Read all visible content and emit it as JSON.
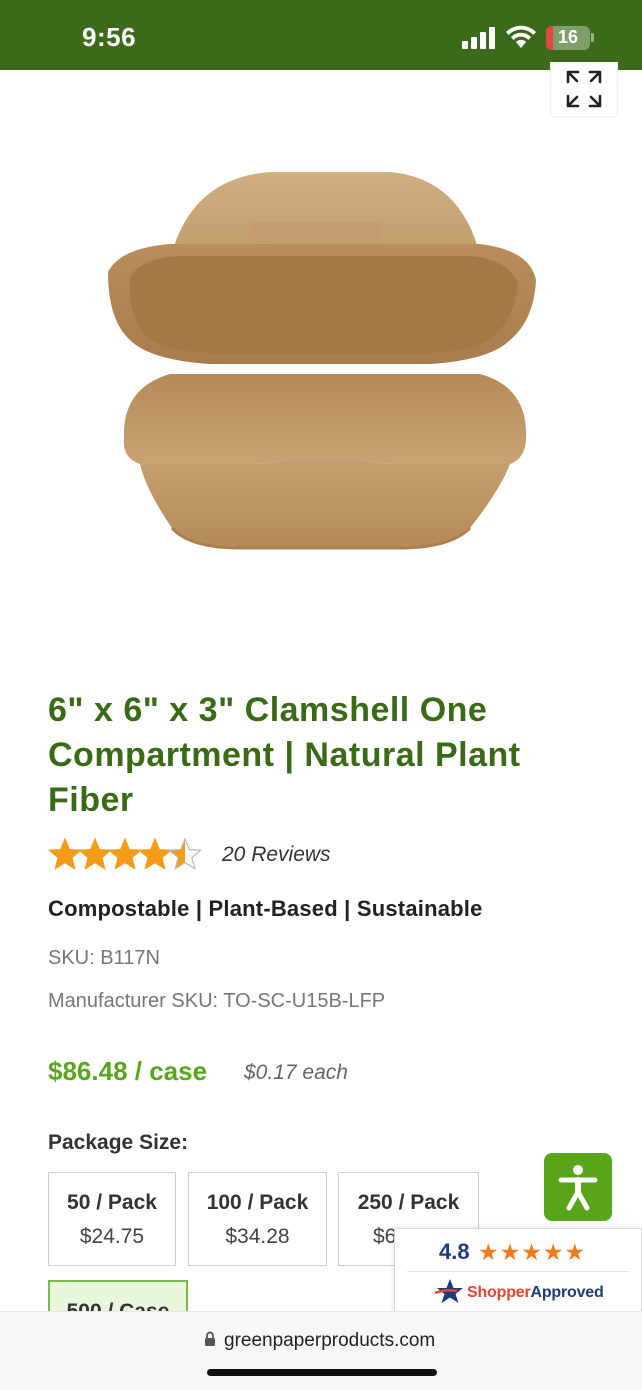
{
  "status_bar": {
    "time": "9:56",
    "battery_level": "16",
    "battery_fraction": 0.16
  },
  "product": {
    "title": "6\" x 6\" x 3\" Clamshell One Compartment | Natural Plant Fiber",
    "rating": 4.5,
    "reviews_label": "20 Reviews",
    "tagline": "Compostable | Plant-Based | Sustainable",
    "sku": "SKU: B117N",
    "manufacturer_sku": "Manufacturer SKU: TO-SC-U15B-LFP",
    "price": "$86.48 / case",
    "unit_price": "$0.17 each"
  },
  "package": {
    "label": "Package Size:",
    "options": [
      {
        "name": "50 / Pack",
        "price": "$24.75"
      },
      {
        "name": "100 / Pack",
        "price": "$34.28"
      },
      {
        "name": "250 / Pack",
        "price": "$6"
      },
      {
        "name": "500 / Case",
        "price": "",
        "selected": true
      }
    ]
  },
  "shopper_approved": {
    "rating": "4.8",
    "stars": "★★★★★",
    "brand_part1": "Shopper",
    "brand_part2": "Approved"
  },
  "browser": {
    "url": "greenpaperproducts.com"
  },
  "colors": {
    "brand_green": "#3c6a1a",
    "title_green": "#3a6a16",
    "price_green": "#5aa51c",
    "star_orange": "#f59b16"
  }
}
